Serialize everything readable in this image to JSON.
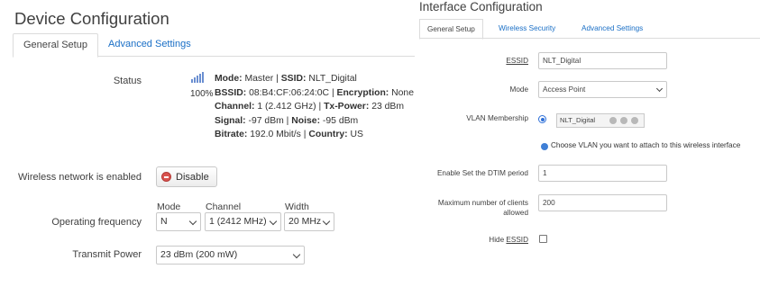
{
  "left": {
    "title": "Device Configuration",
    "tabs": [
      {
        "label": "General Setup",
        "active": true
      },
      {
        "label": "Advanced Settings",
        "active": false
      }
    ],
    "status": {
      "label": "Status",
      "signal_percent": "100%",
      "lines": {
        "mode_k": "Mode:",
        "mode_v": " Master | ",
        "ssid_k": "SSID:",
        "ssid_v": " NLT_Digital",
        "bssid_k": "BSSID:",
        "bssid_v": " 08:B4:CF:06:24:0C | ",
        "enc_k": "Encryption:",
        "enc_v": " None",
        "chan_k": "Channel:",
        "chan_v": " 1 (2.412 GHz) | ",
        "txp_k": "Tx-Power:",
        "txp_v": " 23 dBm",
        "sig_k": "Signal:",
        "sig_v": " -97 dBm | ",
        "noise_k": "Noise:",
        "noise_v": " -95 dBm",
        "bit_k": "Bitrate:",
        "bit_v": " 192.0 Mbit/s | ",
        "country_k": "Country:",
        "country_v": " US"
      }
    },
    "wireless_enabled": {
      "label": "Wireless network is enabled",
      "button": "Disable"
    },
    "operating_frequency": {
      "label": "Operating frequency",
      "mode_label": "Mode",
      "mode_value": "N",
      "channel_label": "Channel",
      "channel_value": "1 (2412 MHz)",
      "width_label": "Width",
      "width_value": "20 MHz"
    },
    "transmit_power": {
      "label": "Transmit Power",
      "value": "23 dBm (200 mW)"
    }
  },
  "right": {
    "title": "Interface Configuration",
    "tabs": [
      {
        "label": "General Setup",
        "active": true
      },
      {
        "label": "Wireless Security",
        "active": false
      },
      {
        "label": "Advanced Settings",
        "active": false
      }
    ],
    "essid": {
      "label": "ESSID",
      "value": "NLT_Digital"
    },
    "mode": {
      "label": "Mode",
      "value": "Access Point"
    },
    "vlan": {
      "label": "VLAN Membership",
      "value": "NLT_Digital",
      "hint": "Choose VLAN you want to attach to this wireless interface"
    },
    "dtim": {
      "label": "Enable Set the DTIM period",
      "value": "1"
    },
    "max_clients": {
      "label_line1": "Maximum number of clients",
      "label_line2": "allowed",
      "value": "200"
    },
    "hide_essid": {
      "label_prefix": "Hide ",
      "label_essid": "ESSID",
      "checked": false
    }
  },
  "colors": {
    "accent": "#1a6fc6",
    "disable_icon": "#d9534f",
    "radio": "#2d6fd8"
  }
}
